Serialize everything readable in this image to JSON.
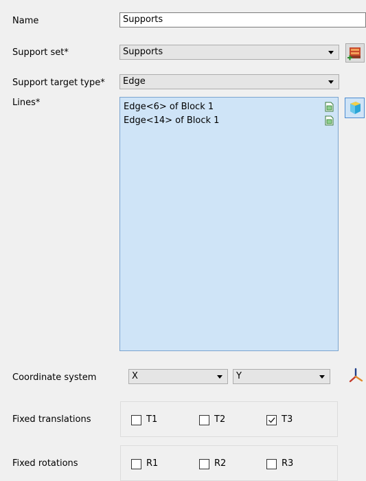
{
  "form": {
    "name_label": "Name",
    "name_value": "Supports",
    "support_set_label": "Support set*",
    "support_set_value": "Supports",
    "target_type_label": "Support target type*",
    "target_type_value": "Edge",
    "lines_label": "Lines*",
    "lines_items": [
      "Edge<6> of Block 1",
      "Edge<14> of Block 1"
    ],
    "coord_label": "Coordinate system",
    "coord_first_value": "X",
    "coord_second_value": "Y",
    "fixed_translations_label": "Fixed translations",
    "translations": [
      {
        "label": "T1",
        "checked": false
      },
      {
        "label": "T2",
        "checked": false
      },
      {
        "label": "T3",
        "checked": true
      }
    ],
    "fixed_rotations_label": "Fixed rotations",
    "rotations": [
      {
        "label": "R1",
        "checked": false
      },
      {
        "label": "R2",
        "checked": false
      },
      {
        "label": "R3",
        "checked": false
      }
    ]
  },
  "colors": {
    "list_background": "#cfe4f7",
    "list_border": "#7aa4cf",
    "window_background": "#f0f0f0"
  },
  "icons": {
    "support_set_add": "add-support-set-icon",
    "lines_pick": "pick-geometry-cube-icon",
    "coordinate_axes": "coordinate-axes-icon",
    "item_remove": "item-document-icon"
  }
}
